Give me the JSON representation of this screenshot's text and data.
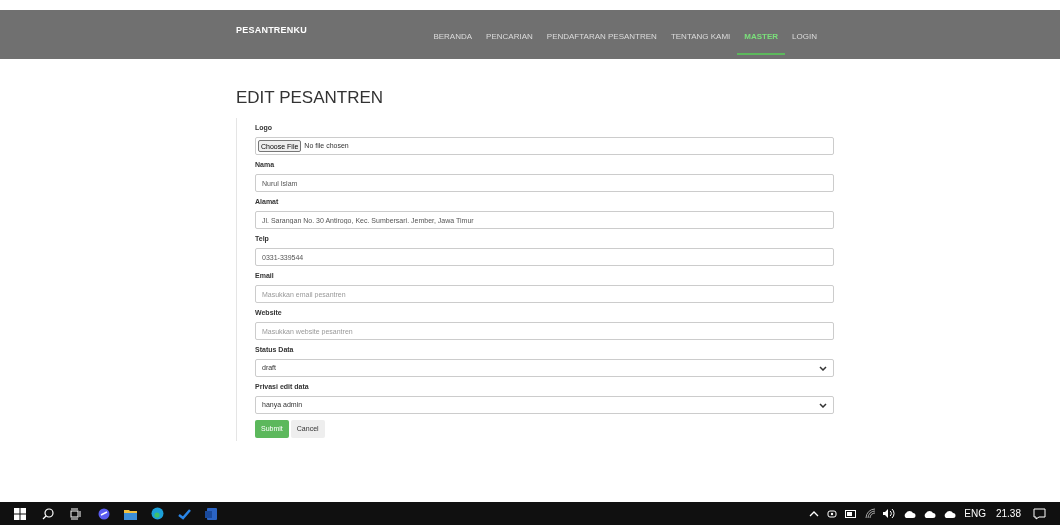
{
  "navbar": {
    "brand": "PESANTRENKU",
    "items": [
      {
        "label": "BERANDA",
        "selected": false
      },
      {
        "label": "PENCARIAN",
        "selected": false
      },
      {
        "label": "PENDAFTARAN PESANTREN",
        "selected": false
      },
      {
        "label": "TENTANG KAMI",
        "selected": false
      },
      {
        "label": "MASTER",
        "selected": true
      },
      {
        "label": "LOGIN",
        "selected": false
      }
    ]
  },
  "page": {
    "title": "EDIT PESANTREN"
  },
  "form": {
    "fields": [
      {
        "kind": "file",
        "label": "Logo",
        "button": "Choose File",
        "value": "No file chosen"
      },
      {
        "kind": "text",
        "label": "Nama",
        "value": "Nurul Islam"
      },
      {
        "kind": "text",
        "label": "Alamat",
        "value": "Jl. Sarangan No. 30 Antirogo, Kec. Sumbersari. Jember, Jawa Timur"
      },
      {
        "kind": "text",
        "label": "Telp",
        "value": "0331-339544"
      },
      {
        "kind": "text",
        "label": "Email",
        "placeholder": "Masukkan email pesantren"
      },
      {
        "kind": "text",
        "label": "Website",
        "placeholder": "Masukkan website pesantren"
      },
      {
        "kind": "select",
        "label": "Status Data",
        "value": "draft"
      },
      {
        "kind": "select",
        "label": "Privasi edit data",
        "value": "hanya admin"
      }
    ],
    "buttons": [
      {
        "label": "Submit",
        "kind": "primary"
      },
      {
        "label": "Cancel",
        "kind": "default"
      }
    ]
  },
  "taskbar": {
    "language": "ENG",
    "time": "21.38"
  }
}
